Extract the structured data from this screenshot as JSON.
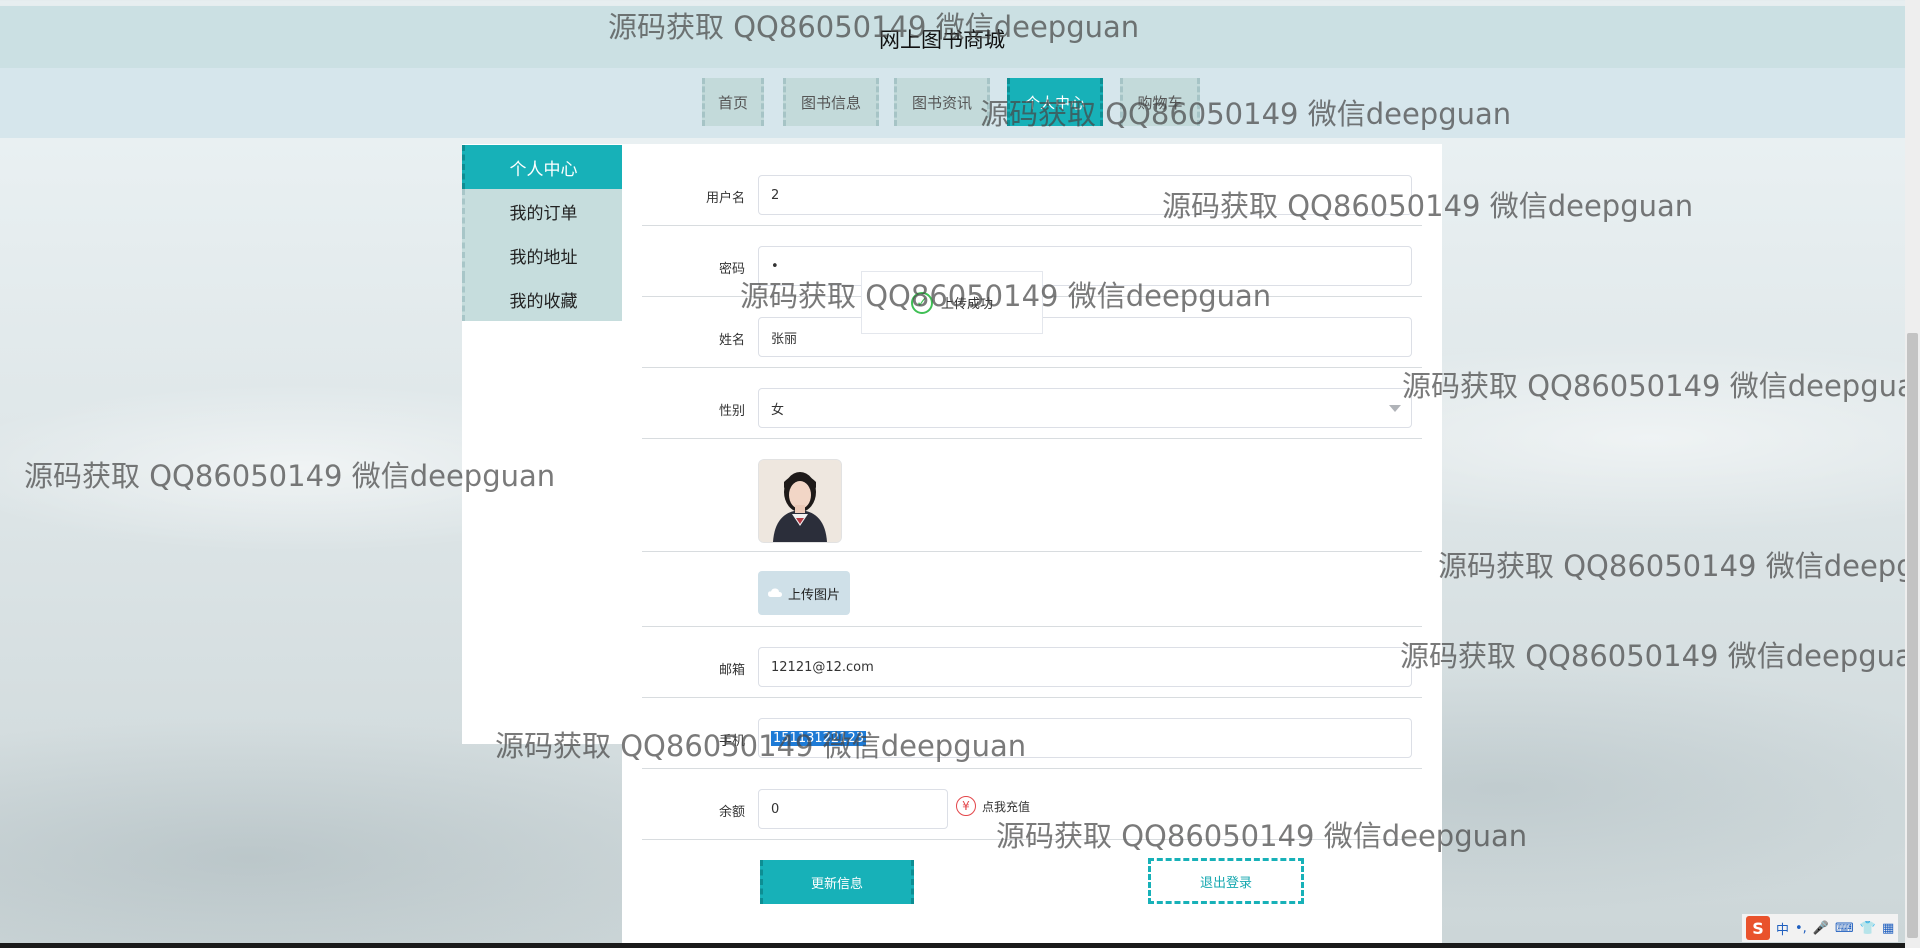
{
  "site": {
    "title": "网上图书商城"
  },
  "nav": [
    "首页",
    "图书信息",
    "图书资讯",
    "个人中心",
    "购物车"
  ],
  "sidebar": [
    "个人中心",
    "我的订单",
    "我的地址",
    "我的收藏"
  ],
  "form": {
    "username_label": "用户名",
    "username_value": "2",
    "password_label": "密码",
    "password_value": "•",
    "name_label": "姓名",
    "name_value": "张丽",
    "gender_label": "性别",
    "gender_value": "女",
    "upload_label": "上传图片",
    "email_label": "邮箱",
    "email_value": "12121@12.com",
    "phone_label": "手机",
    "phone_value": "15113122123",
    "balance_label": "余额",
    "balance_value": "0",
    "recharge_label": "点我充值"
  },
  "buttons": {
    "update": "更新信息",
    "logout": "退出登录"
  },
  "toast": {
    "message": "上传成功"
  },
  "watermark": "源码获取 QQ86050149 微信deepguan",
  "ime": {
    "logo": "S",
    "lang": "中"
  },
  "colors": {
    "accent": "#17b1b8",
    "nav_bg": "#c3dada",
    "toast_success": "#3fbf55",
    "recharge_icon": "#e3464a"
  }
}
